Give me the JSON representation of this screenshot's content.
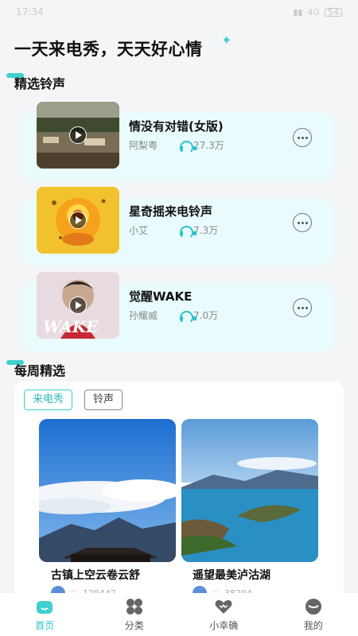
{
  "status": {
    "time": "17:34",
    "network": "4G",
    "battery": "54"
  },
  "header": {
    "title": "一天来电秀，天天好心情"
  },
  "sections": {
    "featured": "精选铃声",
    "weekly": "每周精选"
  },
  "ringtones": [
    {
      "title": "情没有对错(女版)",
      "artist": "阿梨粤",
      "plays": "27.3万"
    },
    {
      "title": "星奇摇来电铃声",
      "artist": "小艾",
      "plays": "7.3万"
    },
    {
      "title": "觉醒WAKE",
      "artist": "孙耀威",
      "plays": "7.0万",
      "cover_text": "WAKE"
    }
  ],
  "weekly": {
    "tabs": [
      {
        "label": "来电秀",
        "active": true
      },
      {
        "label": "铃声",
        "active": false
      }
    ],
    "cards": [
      {
        "title": "古镇上空云卷云舒",
        "likes": "129442"
      },
      {
        "title": "遥望最美泸沽湖",
        "likes": "38294"
      }
    ]
  },
  "tabbar": [
    {
      "label": "首页",
      "icon": "home-icon",
      "active": true
    },
    {
      "label": "分类",
      "icon": "category-icon",
      "active": false
    },
    {
      "label": "小幸确",
      "icon": "heart-icon",
      "active": false
    },
    {
      "label": "我的",
      "icon": "profile-icon",
      "active": false
    }
  ],
  "colors": {
    "accent": "#3fd0d0",
    "card_bg": "#e9fbfc"
  }
}
